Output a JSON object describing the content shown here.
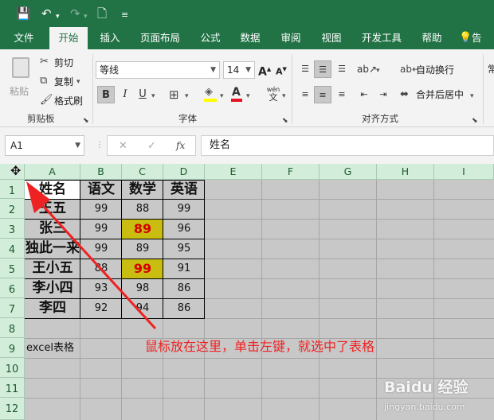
{
  "tabs": [
    "文件",
    "开始",
    "插入",
    "页面布局",
    "公式",
    "数据",
    "审阅",
    "视图",
    "开发工具",
    "帮助",
    "告"
  ],
  "clipboard": {
    "cut": "剪切",
    "copy": "复制",
    "format_painter": "格式刷",
    "paste": "粘贴",
    "group": "剪贴板"
  },
  "font": {
    "name": "等线",
    "size": "14",
    "bold": "B",
    "italic": "I",
    "underline": "U",
    "phonetic_top": "wén",
    "phonetic_bottom": "文",
    "group": "字体"
  },
  "alignment": {
    "wrap": "自动换行",
    "merge": "合并后居中",
    "group": "对齐方式",
    "number_partial": "常"
  },
  "formula_bar": {
    "name_box": "A1",
    "fx": "fx",
    "content": "姓名"
  },
  "columns": [
    "A",
    "B",
    "C",
    "D",
    "E",
    "F",
    "G",
    "H",
    "I"
  ],
  "rows": [
    "1",
    "2",
    "3",
    "4",
    "5",
    "6",
    "7",
    "8",
    "9",
    "10",
    "11",
    "12"
  ],
  "table": {
    "headers": [
      "姓名",
      "语文",
      "数学",
      "英语"
    ],
    "rows": [
      [
        "王五",
        "99",
        "88",
        "99"
      ],
      [
        "张三",
        "99",
        "89",
        "96"
      ],
      [
        "独此一来",
        "99",
        "89",
        "95"
      ],
      [
        "王小五",
        "88",
        "99",
        "91"
      ],
      [
        "李小四",
        "93",
        "98",
        "86"
      ],
      [
        "李四",
        "92",
        "94",
        "86"
      ]
    ],
    "highlights": [
      {
        "row": 1,
        "col": 2
      },
      {
        "row": 3,
        "col": 2
      }
    ]
  },
  "a9_text": "excel表格",
  "annotation": "鼠标放在这里，单击左键，就选中了表格",
  "watermark": {
    "brand": "Baidu 经验",
    "url": "jingyan.baidu.com"
  },
  "colors": {
    "ribbon_green": "#217346",
    "selection": "#c8c8c8",
    "highlight_fill": "#c8bd10",
    "highlight_text": "#d40000",
    "annotation": "#ee2222"
  }
}
